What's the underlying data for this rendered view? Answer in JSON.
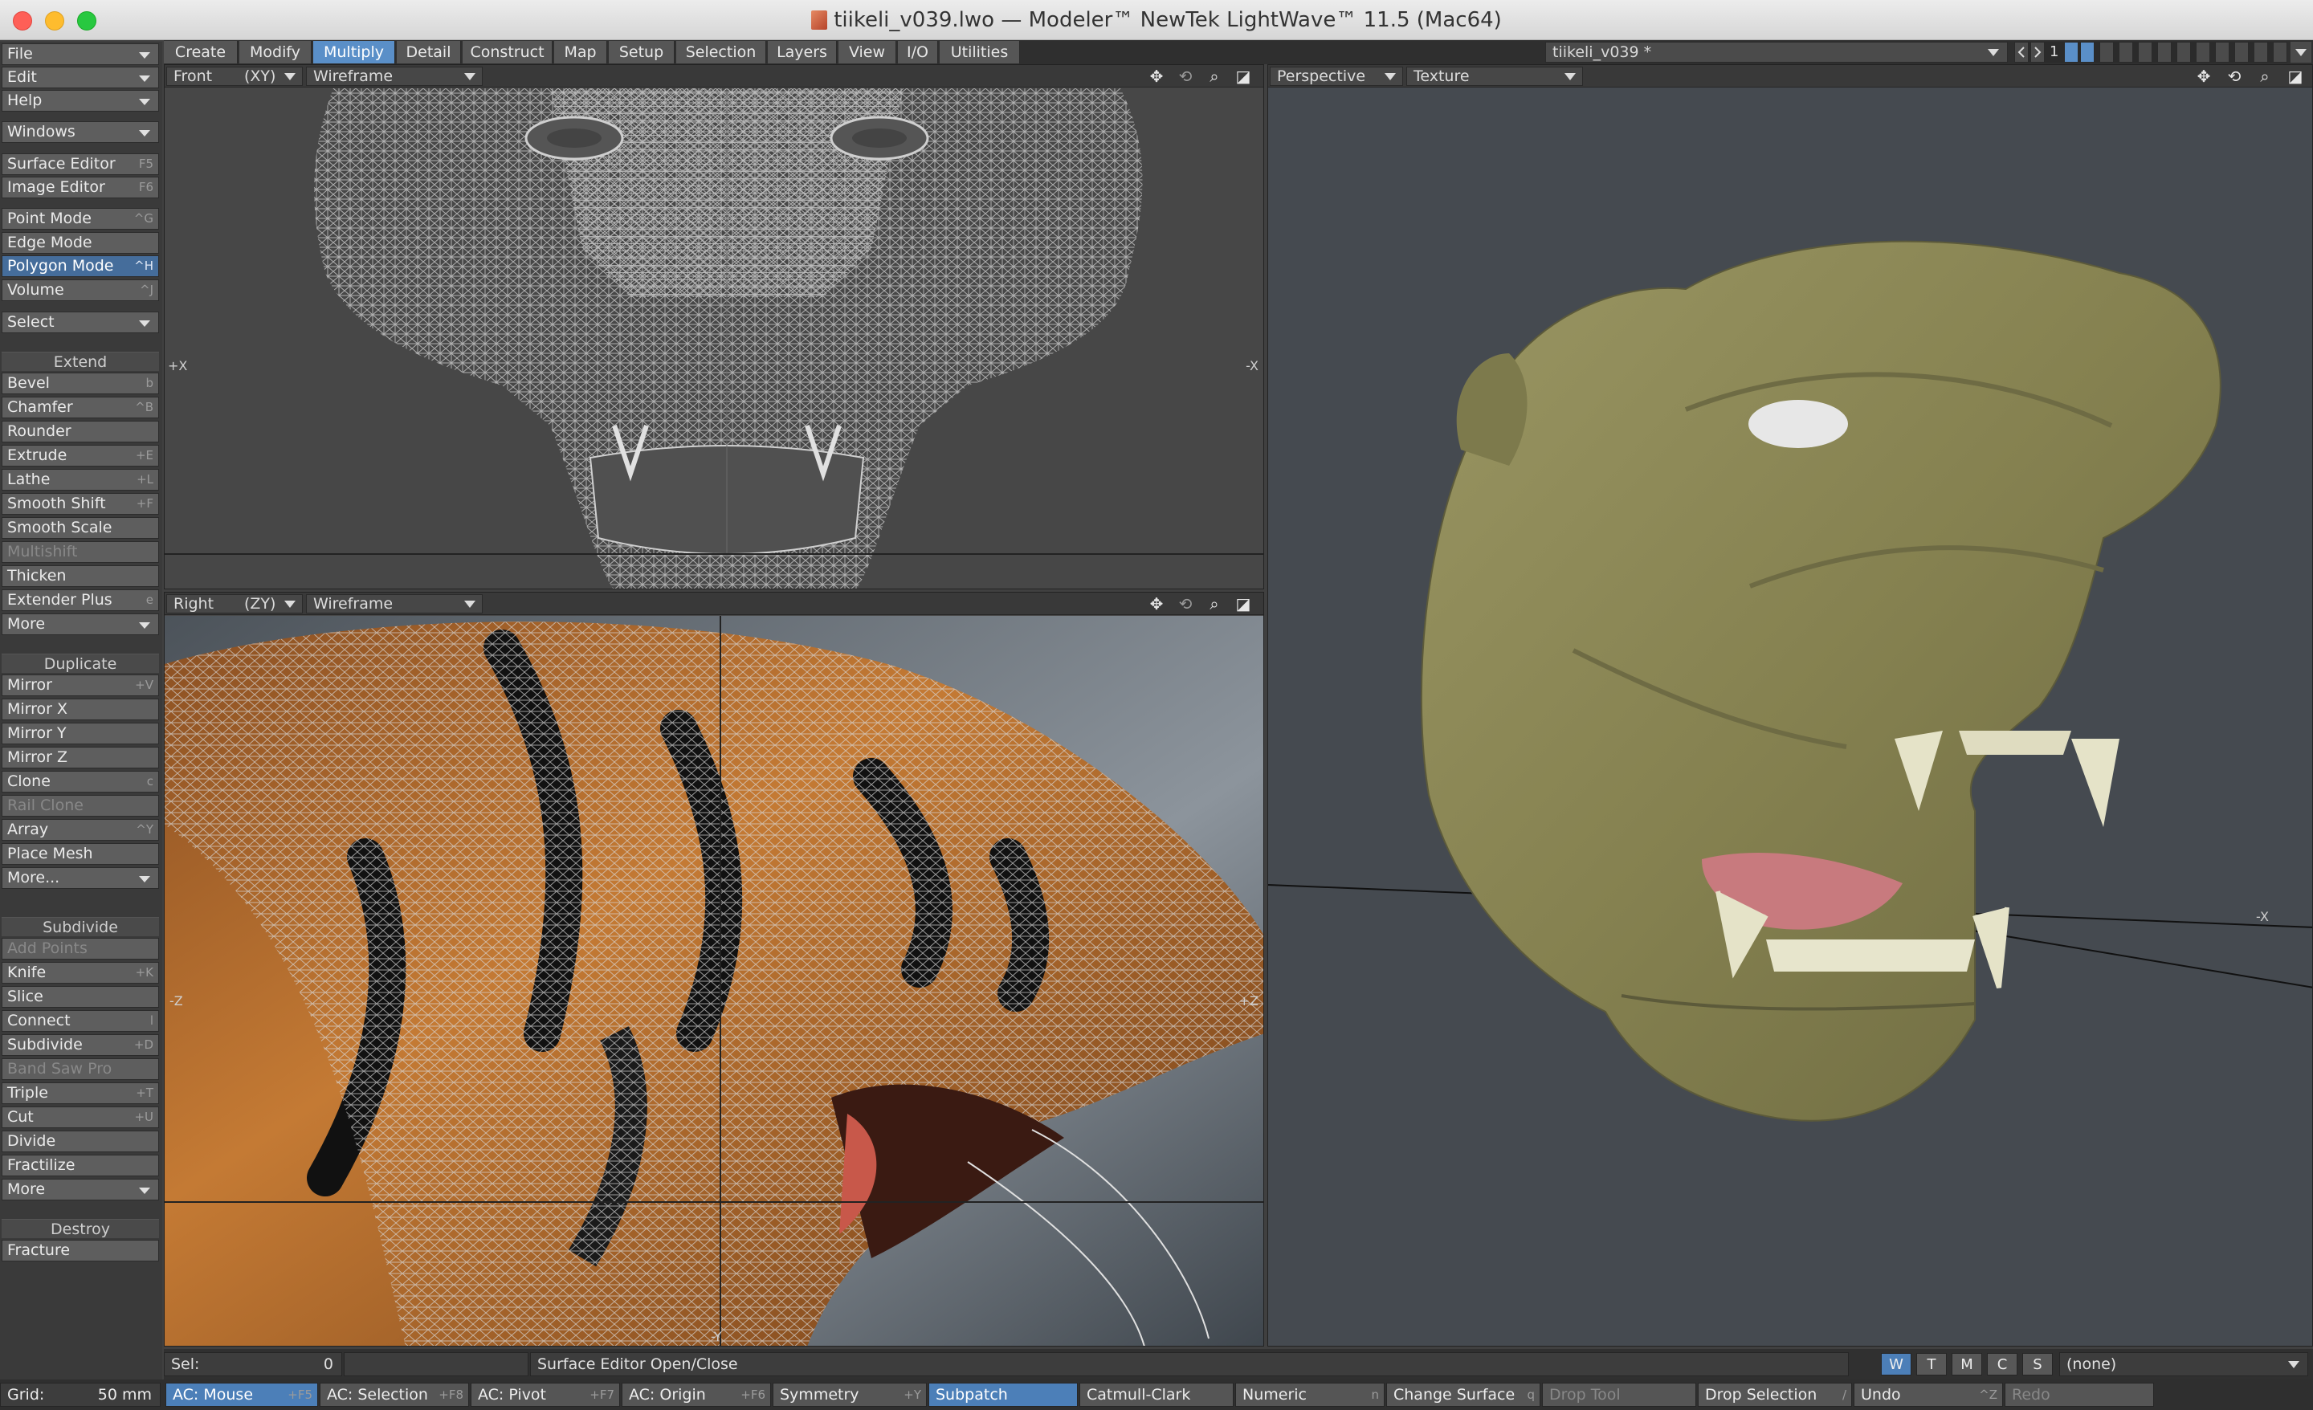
{
  "window": {
    "title": "tiikeli_v039.lwo — Modeler™ NewTek LightWave™ 11.5 (Mac64)"
  },
  "left_panel": {
    "menus": [
      {
        "label": "File"
      },
      {
        "label": "Edit"
      },
      {
        "label": "Help"
      },
      {
        "label": "Windows"
      }
    ],
    "editors": [
      {
        "label": "Surface Editor",
        "shortcut": "F5"
      },
      {
        "label": "Image Editor",
        "shortcut": "F6"
      }
    ],
    "modes": [
      {
        "label": "Point Mode",
        "shortcut": "^G"
      },
      {
        "label": "Edge Mode",
        "shortcut": ""
      },
      {
        "label": "Polygon Mode",
        "shortcut": "^H"
      },
      {
        "label": "Volume",
        "shortcut": "^J"
      }
    ],
    "select": "Select",
    "extend": {
      "title": "Extend",
      "items": [
        {
          "label": "Bevel",
          "shortcut": "b"
        },
        {
          "label": "Chamfer",
          "shortcut": "^B"
        },
        {
          "label": "Rounder",
          "shortcut": ""
        },
        {
          "label": "Extrude",
          "shortcut": "+E"
        },
        {
          "label": "Lathe",
          "shortcut": "+L"
        },
        {
          "label": "Smooth Shift",
          "shortcut": "+F"
        },
        {
          "label": "Smooth Scale",
          "shortcut": ""
        },
        {
          "label": "Multishift",
          "shortcut": ""
        },
        {
          "label": "Thicken",
          "shortcut": ""
        },
        {
          "label": "Extender Plus",
          "shortcut": "e"
        },
        {
          "label": "More",
          "shortcut": ""
        }
      ]
    },
    "duplicate": {
      "title": "Duplicate",
      "items": [
        {
          "label": "Mirror",
          "shortcut": "+V"
        },
        {
          "label": "Mirror X",
          "shortcut": ""
        },
        {
          "label": "Mirror Y",
          "shortcut": ""
        },
        {
          "label": "Mirror Z",
          "shortcut": ""
        },
        {
          "label": "Clone",
          "shortcut": "c"
        },
        {
          "label": "Rail Clone",
          "shortcut": ""
        },
        {
          "label": "Array",
          "shortcut": "^Y"
        },
        {
          "label": "Place Mesh",
          "shortcut": ""
        },
        {
          "label": "More...",
          "shortcut": ""
        }
      ]
    },
    "subdivide": {
      "title": "Subdivide",
      "items": [
        {
          "label": "Add Points",
          "shortcut": ""
        },
        {
          "label": "Knife",
          "shortcut": "+K"
        },
        {
          "label": "Slice",
          "shortcut": ""
        },
        {
          "label": "Connect",
          "shortcut": "l"
        },
        {
          "label": "Subdivide",
          "shortcut": "+D"
        },
        {
          "label": "Band Saw Pro",
          "shortcut": ""
        },
        {
          "label": "Triple",
          "shortcut": "+T"
        },
        {
          "label": "Cut",
          "shortcut": "+U"
        },
        {
          "label": "Divide",
          "shortcut": ""
        },
        {
          "label": "Fractilize",
          "shortcut": ""
        },
        {
          "label": "More",
          "shortcut": ""
        }
      ]
    },
    "destroy": {
      "title": "Destroy",
      "items": [
        {
          "label": "Fracture",
          "shortcut": ""
        }
      ]
    }
  },
  "tabs": [
    {
      "label": "Create"
    },
    {
      "label": "Modify"
    },
    {
      "label": "Multiply"
    },
    {
      "label": "Detail"
    },
    {
      "label": "Construct"
    },
    {
      "label": "Map"
    },
    {
      "label": "Setup"
    },
    {
      "label": "Selection"
    },
    {
      "label": "Layers"
    },
    {
      "label": "View"
    },
    {
      "label": "I/O"
    },
    {
      "label": "Utilities"
    }
  ],
  "active_tab": "Multiply",
  "object_selector": "tiikeli_v039 *",
  "layer_number": "1",
  "viewports": {
    "front": {
      "view": "Front",
      "axis": "(XY)",
      "mode": "Wireframe",
      "left_axis": "+X",
      "right_axis": "-X"
    },
    "right": {
      "view": "Right",
      "axis": "(ZY)",
      "mode": "Wireframe",
      "left_axis": "-Z",
      "right_axis": "+Z",
      "bottom_axis": "-Y"
    },
    "perspective": {
      "view": "Perspective",
      "mode": "Texture",
      "axis_label": "-X"
    }
  },
  "status": {
    "sel_label": "Sel:",
    "sel_value": "0",
    "message": "Surface Editor Open/Close",
    "wtmcs": [
      "W",
      "T",
      "M",
      "C",
      "S"
    ],
    "surface": "(none)"
  },
  "footer": {
    "grid_label": "Grid:",
    "grid_value": "50 mm",
    "buttons": [
      {
        "label": "AC: Mouse",
        "shortcut": "+F5"
      },
      {
        "label": "AC: Selection",
        "shortcut": "+F8"
      },
      {
        "label": "AC: Pivot",
        "shortcut": "+F7"
      },
      {
        "label": "AC: Origin",
        "shortcut": "+F6"
      },
      {
        "label": "Symmetry",
        "shortcut": "+Y"
      },
      {
        "label": "Subpatch",
        "shortcut": ""
      },
      {
        "label": "Catmull-Clark",
        "shortcut": ""
      },
      {
        "label": "Numeric",
        "shortcut": "n"
      },
      {
        "label": "Change Surface",
        "shortcut": "q"
      },
      {
        "label": "Drop Tool",
        "shortcut": ""
      },
      {
        "label": "Drop Selection",
        "shortcut": "/"
      },
      {
        "label": "Undo",
        "shortcut": "^Z"
      },
      {
        "label": "Redo",
        "shortcut": ""
      }
    ]
  },
  "colors": {
    "accent": "#5a8fc8",
    "selected_mode": "#456d9b",
    "model": "#8e8a58"
  }
}
